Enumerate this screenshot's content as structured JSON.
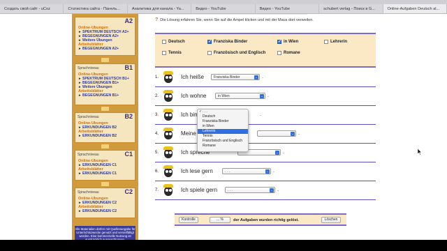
{
  "tabs": [
    "Создать свой сайт - uCoz",
    "Статистика сайта - Панель...",
    "Аналитика для канала - Ya...",
    "Видео - YouTube",
    "Видео - YouTube",
    "schubert verlag - Поиск в G...",
    "Online-Aufgaben Deutsch al..."
  ],
  "sidebar": {
    "blocks": [
      {
        "level_small": "",
        "level_big": "A2",
        "online": "Online-Übungen",
        "links": [
          "SPEKTRUM DEUTSCH A2+",
          "BEGEGNUNGEN A2+",
          "Weitere Übungen"
        ],
        "arbeit": "Arbeitsblätter",
        "arbeit_links": [
          "BEGEGNUNGEN A2+"
        ]
      },
      {
        "level_small": "Sprachniveau",
        "level_big": "B1",
        "online": "Online-Übungen",
        "links": [
          "SPEKTRUM DEUTSCH B1+",
          "BEGEGNUNGEN B1+",
          "Weitere Übungen"
        ],
        "arbeit": "Arbeitsblätter",
        "arbeit_links": [
          "BEGEGNUNGEN B1+"
        ]
      },
      {
        "level_small": "Sprachniveau",
        "level_big": "B2",
        "online": "Online-Übungen",
        "links": [
          "ERKUNDUNGEN B2"
        ],
        "arbeit": "Arbeitsblätter",
        "arbeit_links": [
          "ERKUNDUNGEN B2"
        ]
      },
      {
        "level_small": "Sprachniveau",
        "level_big": "C1",
        "online": "Online-Übungen",
        "links": [
          "ERKUNDUNGEN C1"
        ],
        "arbeit": "Arbeitsblätter",
        "arbeit_links": [
          "ERKUNDUNGEN C1"
        ]
      },
      {
        "level_small": "Sprachniveau",
        "level_big": "C2",
        "online": "Online-Übungen",
        "links": [
          "ERKUNDUNGEN C2"
        ],
        "arbeit": "Arbeitsblätter",
        "arbeit_links": [
          "ERKUNDUNGEN C2"
        ]
      }
    ],
    "note": "Alle Materialien dürfen mit Quellenangabe für Unterrichtszwecke genutzt und vervielfältigt werden. Eine kommerzielle Nutzung ist ausdrücklich ausgeschlossen."
  },
  "help": {
    "icon": "?",
    "text": "Die Lösung erfahren Sie, wenn Sie auf die Ampel klicken und mit der Maus dort verweilen."
  },
  "words": [
    {
      "label": "Deutsch",
      "checked": false
    },
    {
      "label": "Franziska Binder",
      "checked": true
    },
    {
      "label": "in Wien",
      "checked": true
    },
    {
      "label": "Lehrerin",
      "checked": false
    },
    {
      "label": "Tennis",
      "checked": false
    },
    {
      "label": "Französisch und Englisch",
      "checked": false
    },
    {
      "label": "Romane",
      "checked": false
    }
  ],
  "exercises": [
    {
      "num": "1.",
      "text": "Ich heiße",
      "value": "Franziska Binder"
    },
    {
      "num": "2.",
      "text": "Ich wohne",
      "value": "in Wien"
    },
    {
      "num": "3.",
      "text": "Ich bin",
      "value": ""
    },
    {
      "num": "4.",
      "text": "Meine",
      "value": ""
    },
    {
      "num": "5.",
      "text": "Ich spreche",
      "value": ""
    },
    {
      "num": "6.",
      "text": "Ich lese gern",
      "value": ". . ."
    },
    {
      "num": "7.",
      "text": "Ich spiele gern",
      "value": ". . ."
    }
  ],
  "dropdown": {
    "options": [
      ". . .",
      "Deutsch",
      "Franziska Binder",
      "in Wien",
      "Lehrerin",
      "Tennis",
      "Französisch und Englisch",
      "Romane"
    ],
    "highlighted": "Lehrerin",
    "checked": ". . ."
  },
  "footer": {
    "check_button": "Kontrolle",
    "score_value": "... %",
    "score_text": "der Aufgaben wurden richtig gelöst.",
    "clear_button": "Löschen"
  },
  "colors": {
    "sidebar_bg": "#d19a3c",
    "panel_bg": "#fbe9c6",
    "accent_line": "#7a6bd1",
    "link_blue": "#2d3a9a",
    "section_orange": "#d86c00",
    "select_blue": "#2f6fe0"
  }
}
